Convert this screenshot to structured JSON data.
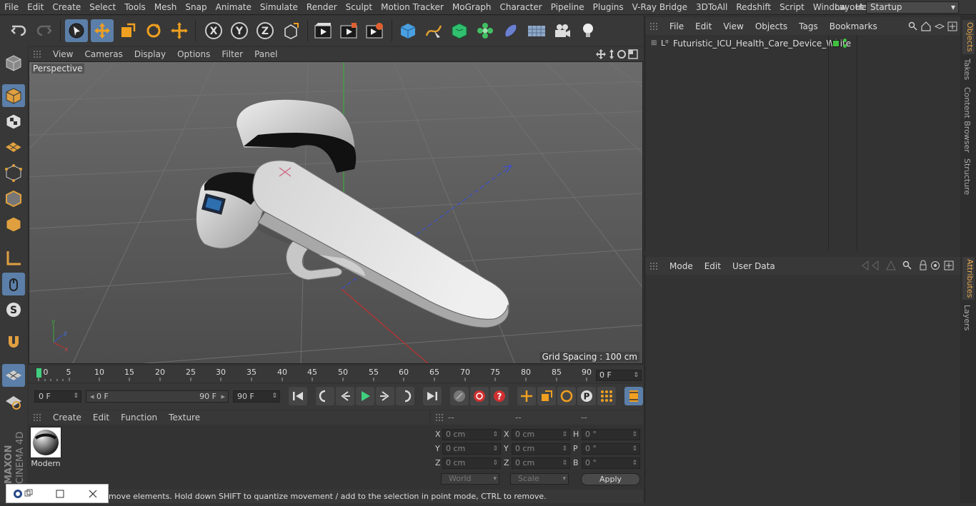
{
  "menubar": {
    "items": [
      "File",
      "Edit",
      "Create",
      "Select",
      "Tools",
      "Mesh",
      "Snap",
      "Animate",
      "Simulate",
      "Render",
      "Sculpt",
      "Motion Tracker",
      "MoGraph",
      "Character",
      "Pipeline",
      "Plugins",
      "V-Ray Bridge",
      "3DToAll",
      "Redshift",
      "Script",
      "Window",
      "Help"
    ],
    "layout_label": "Layout:",
    "layout_value": "Startup"
  },
  "toolbar": {
    "icons": [
      "undo-icon",
      "redo-icon",
      "select-arrow-icon",
      "move-icon",
      "scale-icon",
      "rotate-icon",
      "live-transform-icon",
      "x-axis-icon",
      "y-axis-icon",
      "z-axis-icon",
      "coordinate-system-icon",
      "render-view-icon",
      "render-picture-viewer-icon",
      "render-settings-icon",
      "cube-icon",
      "pen-spline-icon",
      "subdivision-icon",
      "cloner-icon",
      "deformer-icon",
      "floor-icon",
      "camera-icon",
      "light-icon"
    ]
  },
  "viewport": {
    "menu": [
      "View",
      "Cameras",
      "Display",
      "Options",
      "Filter",
      "Panel"
    ],
    "label": "Perspective",
    "grid_spacing": "Grid Spacing : 100 cm"
  },
  "timeline": {
    "ticks": [
      "0",
      "5",
      "10",
      "15",
      "20",
      "25",
      "30",
      "35",
      "40",
      "45",
      "50",
      "55",
      "60",
      "65",
      "70",
      "75",
      "80",
      "85",
      "90"
    ],
    "current_frame": "0 F"
  },
  "transport": {
    "start_frame": "0 F",
    "range_start": "0 F",
    "range_end": "90 F",
    "end_frame": "90 F"
  },
  "material_manager": {
    "menu": [
      "Create",
      "Edit",
      "Function",
      "Texture"
    ],
    "material_name": "Modern"
  },
  "coordinates": {
    "headers": [
      "--",
      "--",
      "--"
    ],
    "rows": [
      {
        "l1": "X",
        "v1": "0 cm",
        "l2": "X",
        "v2": "0 cm",
        "l3": "H",
        "v3": "0 °"
      },
      {
        "l1": "Y",
        "v1": "0 cm",
        "l2": "Y",
        "v2": "0 cm",
        "l3": "P",
        "v3": "0 °"
      },
      {
        "l1": "Z",
        "v1": "0 cm",
        "l2": "Z",
        "v2": "0 cm",
        "l3": "B",
        "v3": "0 °"
      }
    ],
    "world": "World",
    "scale": "Scale",
    "apply": "Apply"
  },
  "object_manager": {
    "menu": [
      "File",
      "Edit",
      "View",
      "Objects",
      "Tags",
      "Bookmarks"
    ],
    "object_name": "Futuristic_ICU_Health_Care_Device_White"
  },
  "attribute_manager": {
    "menu": [
      "Mode",
      "Edit",
      "User Data"
    ]
  },
  "side_tabs": [
    "Objects",
    "Takes",
    "Content Browser",
    "Structure",
    "Attributes",
    "Layers"
  ],
  "status": "move elements. Hold down SHIFT to quantize movement / add to the selection in point mode, CTRL to remove.",
  "branding": {
    "line1": "MAXON",
    "line2": "CINEMA 4D"
  },
  "colors": {
    "accent": "#5b7fa8",
    "tab_active": "#e5a74c",
    "object_tag": "#40c040"
  }
}
